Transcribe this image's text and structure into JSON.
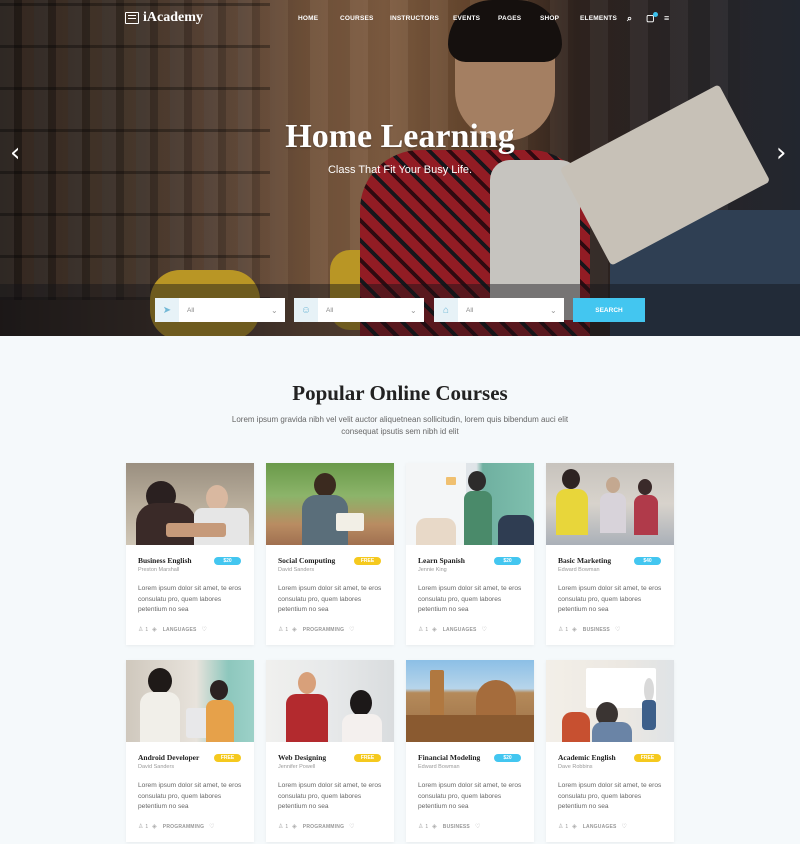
{
  "header": {
    "brand": "iAcademy",
    "nav": [
      "HOME",
      "COURSES",
      "INSTRUCTORS",
      "EVENTS",
      "PAGES",
      "SHOP",
      "ELEMENTS"
    ]
  },
  "hero": {
    "title": "Home Learning",
    "subtitle": "Class That Fit Your Busy Life."
  },
  "search": {
    "fields": [
      {
        "value": "All",
        "icon": "map-pin-icon"
      },
      {
        "value": "All",
        "icon": "user-icon"
      },
      {
        "value": "All",
        "icon": "tag-icon"
      }
    ],
    "button": "SEARCH"
  },
  "section": {
    "title": "Popular Online Courses",
    "description": "Lorem ipsum gravida nibh vel velit auctor aliquetnean sollicitudin, lorem quis bibendum auci elit consequat ipsutis sem nibh id elit"
  },
  "colors": {
    "accent": "#43c6f0",
    "free": "#f5c91e",
    "paid": "#43c6f0"
  },
  "courses": [
    {
      "title": "Business English",
      "price": "$20",
      "author": "Preston Marshall",
      "desc": "Lorem ipsum dolor sit amet, te eros consulatu pro, quem labores petentium no sea",
      "students": "1",
      "category": "LANGUAGES"
    },
    {
      "title": "Social Computing",
      "price": "FREE",
      "author": "David Sanders",
      "desc": "Lorem ipsum dolor sit amet, te eros consulatu pro, quem labores petentium no sea",
      "students": "1",
      "category": "PROGRAMMING"
    },
    {
      "title": "Learn Spanish",
      "price": "$20",
      "author": "Jennie King",
      "desc": "Lorem ipsum dolor sit amet, te eros consulatu pro, quem labores petentium no sea",
      "students": "1",
      "category": "LANGUAGES"
    },
    {
      "title": "Basic Marketing",
      "price": "$40",
      "author": "Edward Bowman",
      "desc": "Lorem ipsum dolor sit amet, te eros consulatu pro, quem labores petentium no sea",
      "students": "1",
      "category": "BUSINESS"
    },
    {
      "title": "Android Developer",
      "price": "FREE",
      "author": "David Sanders",
      "desc": "Lorem ipsum dolor sit amet, te eros consulatu pro, quem labores petentium no sea",
      "students": "1",
      "category": "PROGRAMMING"
    },
    {
      "title": "Web Designing",
      "price": "FREE",
      "author": "Jennifer Powell",
      "desc": "Lorem ipsum dolor sit amet, te eros consulatu pro, quem labores petentium no sea",
      "students": "1",
      "category": "PROGRAMMING"
    },
    {
      "title": "Financial Modeling",
      "price": "$20",
      "author": "Edward Bowman",
      "desc": "Lorem ipsum dolor sit amet, te eros consulatu pro, quem labores petentium no sea",
      "students": "1",
      "category": "BUSINESS"
    },
    {
      "title": "Academic English",
      "price": "FREE",
      "author": "Dave Robbins",
      "desc": "Lorem ipsum dolor sit amet, te eros consulatu pro, quem labores petentium no sea",
      "students": "1",
      "category": "LANGUAGES"
    }
  ]
}
